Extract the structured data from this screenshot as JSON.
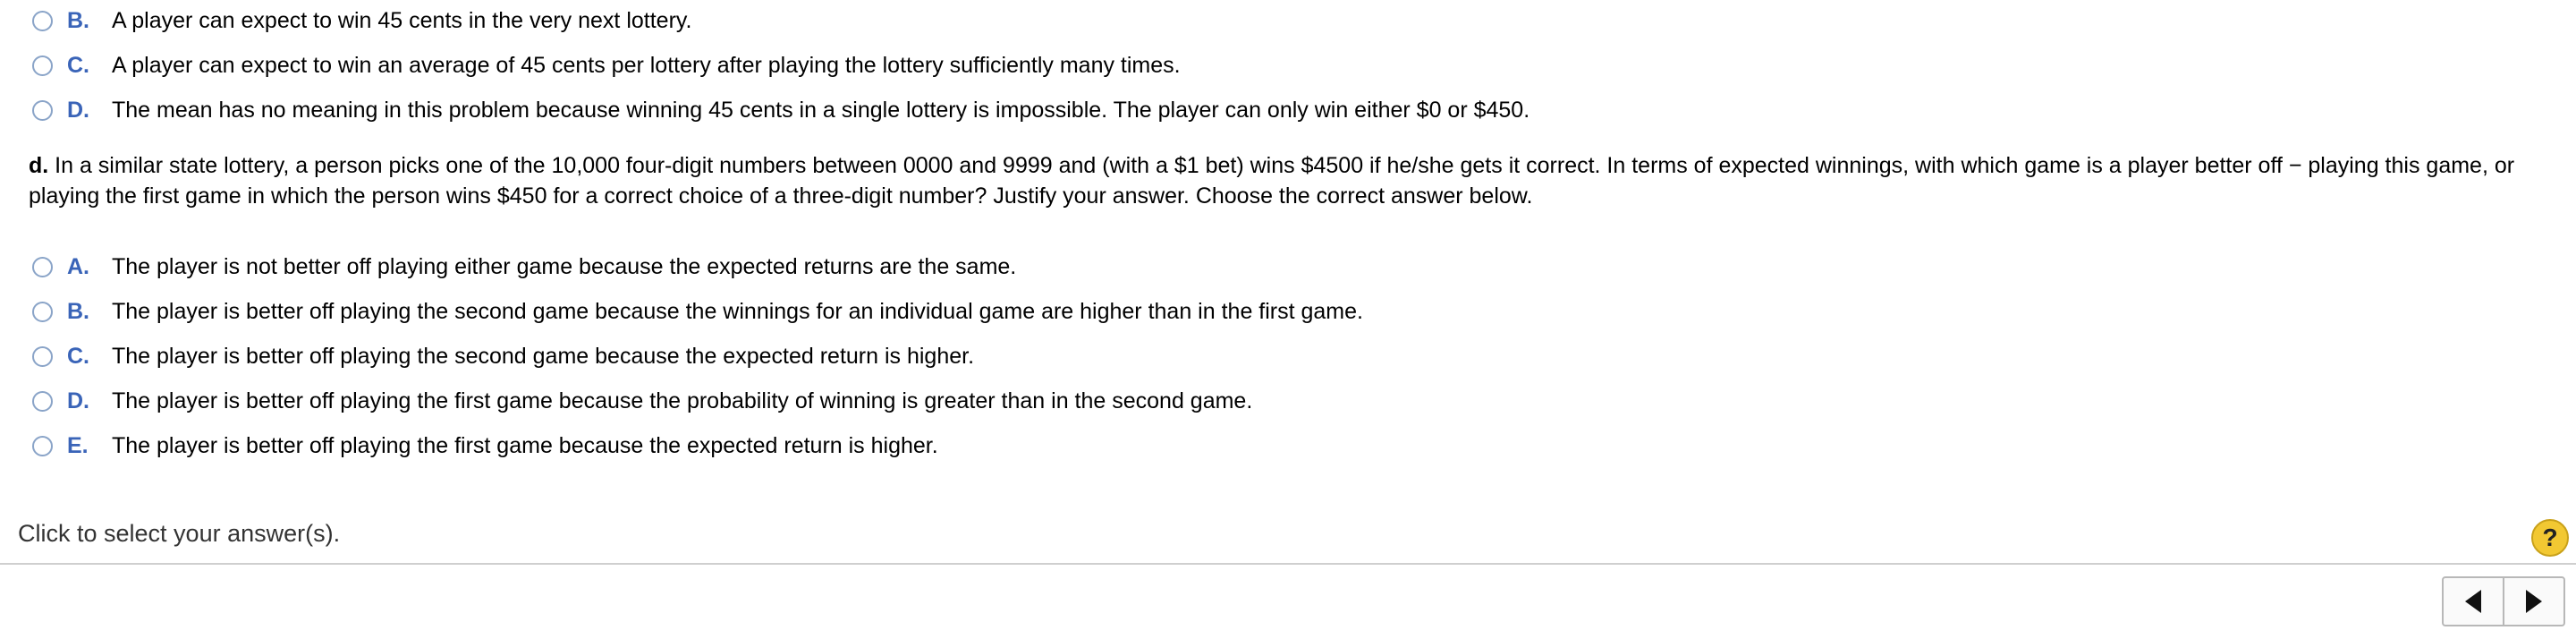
{
  "options_top": [
    {
      "letter": "B.",
      "text": "A player can expect to win 45 cents in the very next lottery."
    },
    {
      "letter": "C.",
      "text": "A player can expect to win an average of 45 cents per lottery after playing the lottery sufficiently many times."
    },
    {
      "letter": "D.",
      "text": "The mean has no meaning in this problem because winning 45 cents in a single lottery is impossible. The player can only win either $0 or $450."
    }
  ],
  "question_d": {
    "label": "d.",
    "text": " In a similar state lottery, a person picks one of the 10,000 four-digit numbers between 0000 and 9999 and (with a $1 bet) wins $4500 if he/she gets it correct. In terms of expected winnings, with which game is a player better off − playing this game, or playing the first game in which the person wins $450 for a correct choice of a three-digit number? Justify your answer. Choose the correct answer below."
  },
  "options_d": [
    {
      "letter": "A.",
      "text": "The player is not better off playing either game because the expected returns are the same."
    },
    {
      "letter": "B.",
      "text": "The player is better off playing the second game because the winnings for an individual game are higher than in the first game."
    },
    {
      "letter": "C.",
      "text": "The player is better off playing the second game because the expected return is higher."
    },
    {
      "letter": "D.",
      "text": "The player is better off playing the first game because the probability of winning is greater than in the second game."
    },
    {
      "letter": "E.",
      "text": "The player is better off playing the first game because the expected return is higher."
    }
  ],
  "footer": {
    "instruction": "Click to select your answer(s).",
    "help_label": "?"
  },
  "colors": {
    "letter": "#3a64b8",
    "radio_border": "#8aa4c8",
    "help_button": "#f2c832"
  },
  "icons": {
    "radio": "radio-button-icon",
    "help": "help-icon",
    "prev": "triangle-left-icon",
    "next": "triangle-right-icon"
  }
}
